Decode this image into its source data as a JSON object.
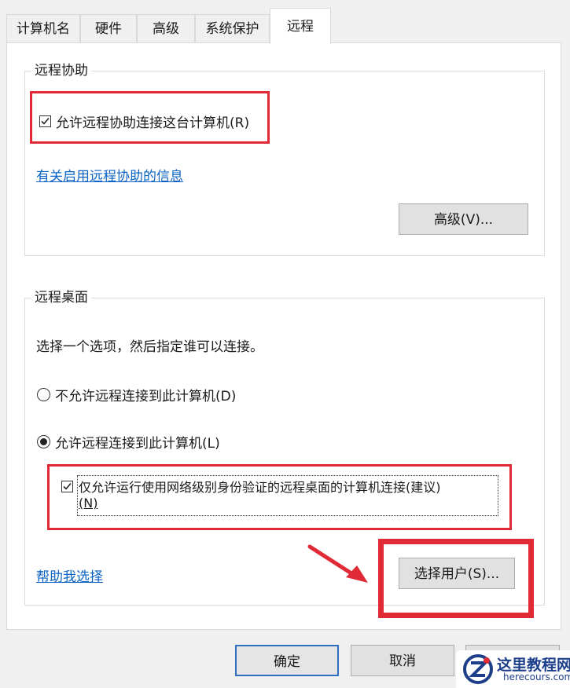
{
  "tabs": [
    {
      "label": "计算机名",
      "active": false
    },
    {
      "label": "硬件",
      "active": false
    },
    {
      "label": "高级",
      "active": false
    },
    {
      "label": "系统保护",
      "active": false
    },
    {
      "label": "远程",
      "active": true
    }
  ],
  "remote_assistance": {
    "title": "远程协助",
    "allow_label": "允许远程协助连接这台计算机(R)",
    "allow_checked": true,
    "info_link": "有关启用远程协助的信息",
    "advanced_button": "高级(V)..."
  },
  "remote_desktop": {
    "title": "远程桌面",
    "instruction": "选择一个选项，然后指定谁可以连接。",
    "option_deny": "不允许远程连接到此计算机(D)",
    "option_allow": "允许远程连接到此计算机(L)",
    "selected_option": "allow",
    "nla_label_line1": "仅允许运行使用网络级别身份验证的远程桌面的计算机连接(建议)",
    "nla_label_line2": "(N)",
    "nla_checked": true,
    "help_link": "帮助我选择",
    "select_users_button": "选择用户(S)..."
  },
  "footer": {
    "ok_button": "确定",
    "cancel_button": "取消"
  },
  "watermark": {
    "text_cn": "这里教程网",
    "text_en": "herecours.com"
  },
  "colors": {
    "highlight_red": "#e02b36",
    "link_blue": "#0b63c5",
    "default_button_border": "#2f6fbf"
  }
}
